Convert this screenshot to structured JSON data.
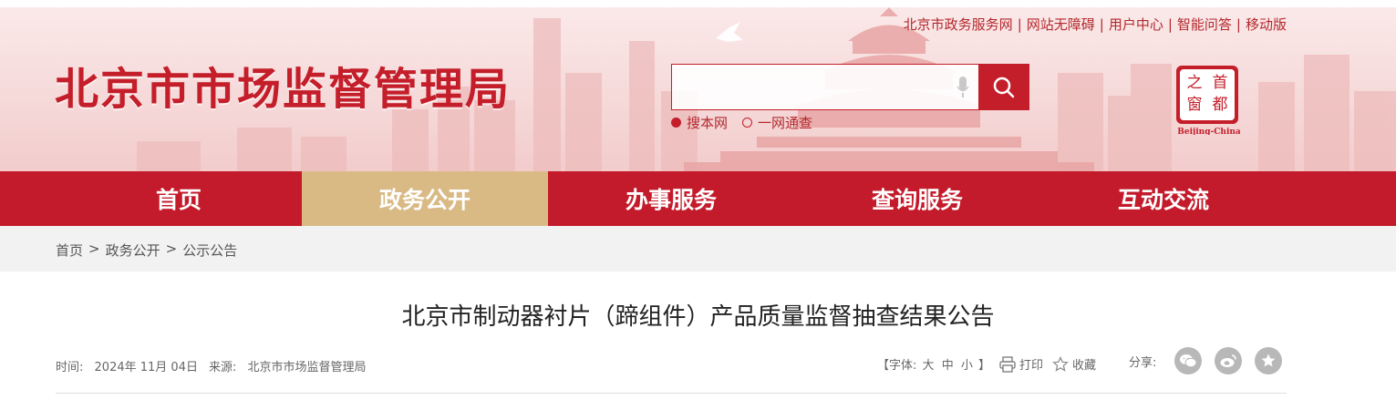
{
  "header": {
    "site_title": "北京市市场监督管理局",
    "top_links": [
      "北京市政务服务网",
      "网站无障碍",
      "用户中心",
      "智能问答",
      "移动版"
    ],
    "search": {
      "placeholder": "",
      "options": [
        {
          "label": "搜本网",
          "selected": true
        },
        {
          "label": "一网通查",
          "selected": false
        }
      ]
    },
    "capital_logo": {
      "chars": [
        "首",
        "都",
        "之",
        "窗"
      ],
      "caption": "Beijing-China"
    }
  },
  "nav": {
    "items": [
      {
        "label": "首页",
        "active": false
      },
      {
        "label": "政务公开",
        "active": true
      },
      {
        "label": "办事服务",
        "active": false
      },
      {
        "label": "查询服务",
        "active": false
      },
      {
        "label": "互动交流",
        "active": false
      }
    ]
  },
  "breadcrumb": {
    "items": [
      "首页",
      "政务公开",
      "公示公告"
    ],
    "separator": ">"
  },
  "article": {
    "title": "北京市制动器衬片（蹄组件）产品质量监督抽查结果公告",
    "time_label": "时间:",
    "time_value": "2024年 11月 04日",
    "source_label": "来源:",
    "source_value": "北京市市场监督管理局",
    "font_label_open": "【字体:",
    "font_sizes": [
      "大",
      "中",
      "小"
    ],
    "font_label_close": "】",
    "print_label": "打印",
    "favorite_label": "收藏",
    "share_label": "分享:"
  },
  "colors": {
    "brand_red": "#c31b2b",
    "active_gold": "#d9ba85",
    "breadcrumb_bg": "#f2f2f2"
  }
}
